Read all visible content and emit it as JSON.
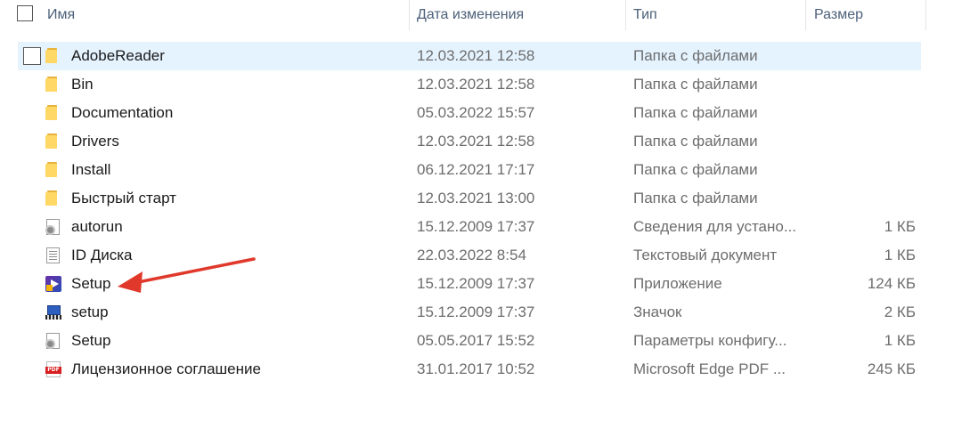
{
  "header": {
    "col_name": "Имя",
    "col_date": "Дата изменения",
    "col_type": "Тип",
    "col_size": "Размер"
  },
  "files": [
    {
      "name": "AdobeReader",
      "date": "12.03.2021 12:58",
      "type": "Папка с файлами",
      "size": "",
      "icon": "folder-icon",
      "selected": true
    },
    {
      "name": "Bin",
      "date": "12.03.2021 12:58",
      "type": "Папка с файлами",
      "size": "",
      "icon": "folder-icon"
    },
    {
      "name": "Documentation",
      "date": "05.03.2022 15:57",
      "type": "Папка с файлами",
      "size": "",
      "icon": "folder-icon"
    },
    {
      "name": "Drivers",
      "date": "12.03.2021 12:58",
      "type": "Папка с файлами",
      "size": "",
      "icon": "folder-icon"
    },
    {
      "name": "Install",
      "date": "06.12.2021 17:17",
      "type": "Папка с файлами",
      "size": "",
      "icon": "folder-icon"
    },
    {
      "name": "Быстрый старт",
      "date": "12.03.2021 13:00",
      "type": "Папка с файлами",
      "size": "",
      "icon": "folder-icon"
    },
    {
      "name": "autorun",
      "date": "15.12.2009 17:37",
      "type": "Сведения для устано...",
      "size": "1 КБ",
      "icon": "settings-file-icon"
    },
    {
      "name": "ID Диска",
      "date": "22.03.2022 8:54",
      "type": "Текстовый документ",
      "size": "1 КБ",
      "icon": "text-file-icon"
    },
    {
      "name": "Setup",
      "date": "15.12.2009 17:37",
      "type": "Приложение",
      "size": "124 КБ",
      "icon": "application-icon"
    },
    {
      "name": "setup",
      "date": "15.12.2009 17:37",
      "type": "Значок",
      "size": "2 КБ",
      "icon": "ico-file-icon"
    },
    {
      "name": "Setup",
      "date": "05.05.2017 15:52",
      "type": "Параметры конфигу...",
      "size": "1 КБ",
      "icon": "settings-file-icon"
    },
    {
      "name": "Лицензионное соглашение",
      "date": "31.01.2017 10:52",
      "type": "Microsoft Edge PDF ...",
      "size": "245 КБ",
      "icon": "pdf-icon"
    }
  ],
  "colors": {
    "selection": "#e5f3ff",
    "header_text": "#4c607a",
    "arrow": "#e0392b"
  }
}
